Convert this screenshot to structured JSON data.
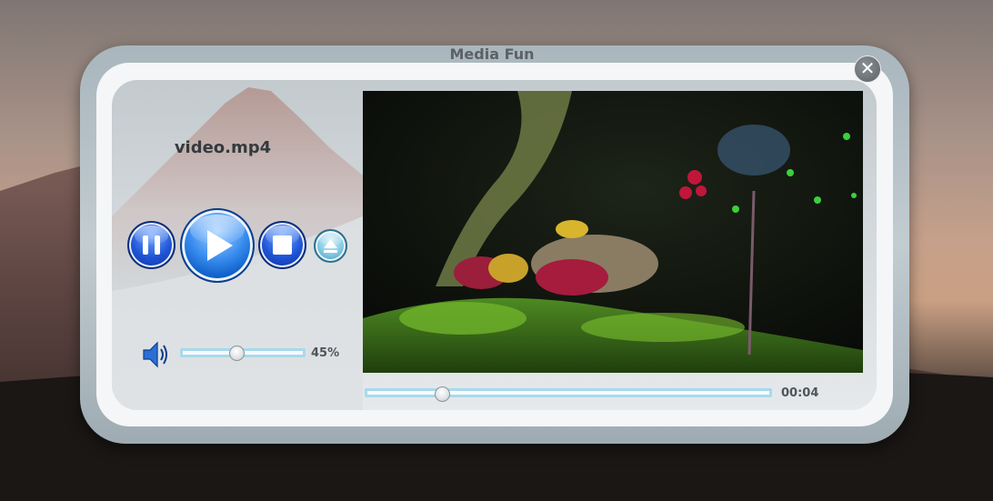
{
  "window": {
    "title": "Media Fun",
    "close_symbol": "✕"
  },
  "player": {
    "file_name": "video.mp4",
    "controls": {
      "pause": "pause-icon",
      "play": "play-icon",
      "stop": "stop-icon",
      "eject": "eject-icon"
    },
    "volume": {
      "icon": "speaker-icon",
      "level": 0.45,
      "label": "45%"
    },
    "seek": {
      "position": 0.19,
      "time_label": "00:04"
    }
  },
  "colors": {
    "button_blue": "#1f54d6",
    "slider_border": "#a9d9ec",
    "frame": "#a9b6bd"
  }
}
